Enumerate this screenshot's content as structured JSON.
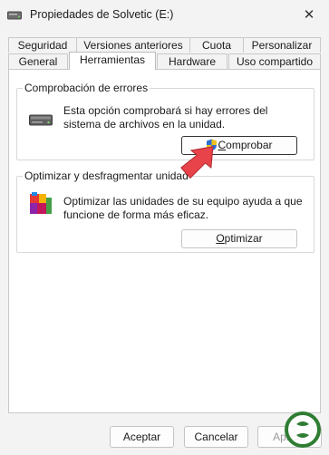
{
  "window": {
    "title": "Propiedades de Solvetic (E:)",
    "close_symbol": "✕"
  },
  "tabs": {
    "row1": [
      "Seguridad",
      "Versiones anteriores",
      "Cuota",
      "Personalizar"
    ],
    "row2": [
      "General",
      "Herramientas",
      "Hardware",
      "Uso compartido"
    ],
    "active": "Herramientas"
  },
  "error_check": {
    "title": "Comprobación de errores",
    "description_line1": "Esta opción comprobará si hay errores del",
    "description_line2": "sistema de archivos en la unidad.",
    "button_label_first": "C",
    "button_label_rest": "omprobar",
    "icon": "drive-icon"
  },
  "optimize": {
    "title": "Optimizar y desfragmentar unidad",
    "description_line1": "Optimizar las unidades de su equipo ayuda a que",
    "description_line2": "funcione de forma más eficaz.",
    "button_label_first": "O",
    "button_label_rest": "ptimizar",
    "icon": "defrag-icon"
  },
  "footer": {
    "accept": "Aceptar",
    "cancel": "Cancelar",
    "apply": "Aplicar"
  },
  "colors": {
    "arrow": "#e8434a",
    "watermark_green": "#2e7d32",
    "accent": "#0067c0"
  }
}
